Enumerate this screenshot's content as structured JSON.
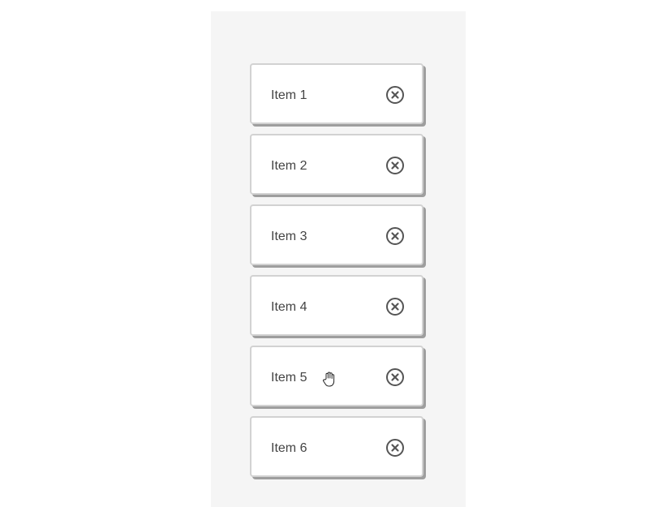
{
  "items": [
    {
      "label": "Item 1",
      "remove_icon": "close-circle-icon"
    },
    {
      "label": "Item 2",
      "remove_icon": "close-circle-icon"
    },
    {
      "label": "Item 3",
      "remove_icon": "close-circle-icon"
    },
    {
      "label": "Item 4",
      "remove_icon": "close-circle-icon"
    },
    {
      "label": "Item 5",
      "remove_icon": "close-circle-icon"
    },
    {
      "label": "Item 6",
      "remove_icon": "close-circle-icon"
    }
  ],
  "cursor": {
    "icon": "grab-hand-cursor-icon"
  },
  "colors": {
    "panel_bg": "#f5f5f5",
    "card_bg": "#ffffff",
    "card_border": "#d2d2d2",
    "card_shadow": "#9e9e9e",
    "text": "#444444",
    "icon": "#555555"
  }
}
